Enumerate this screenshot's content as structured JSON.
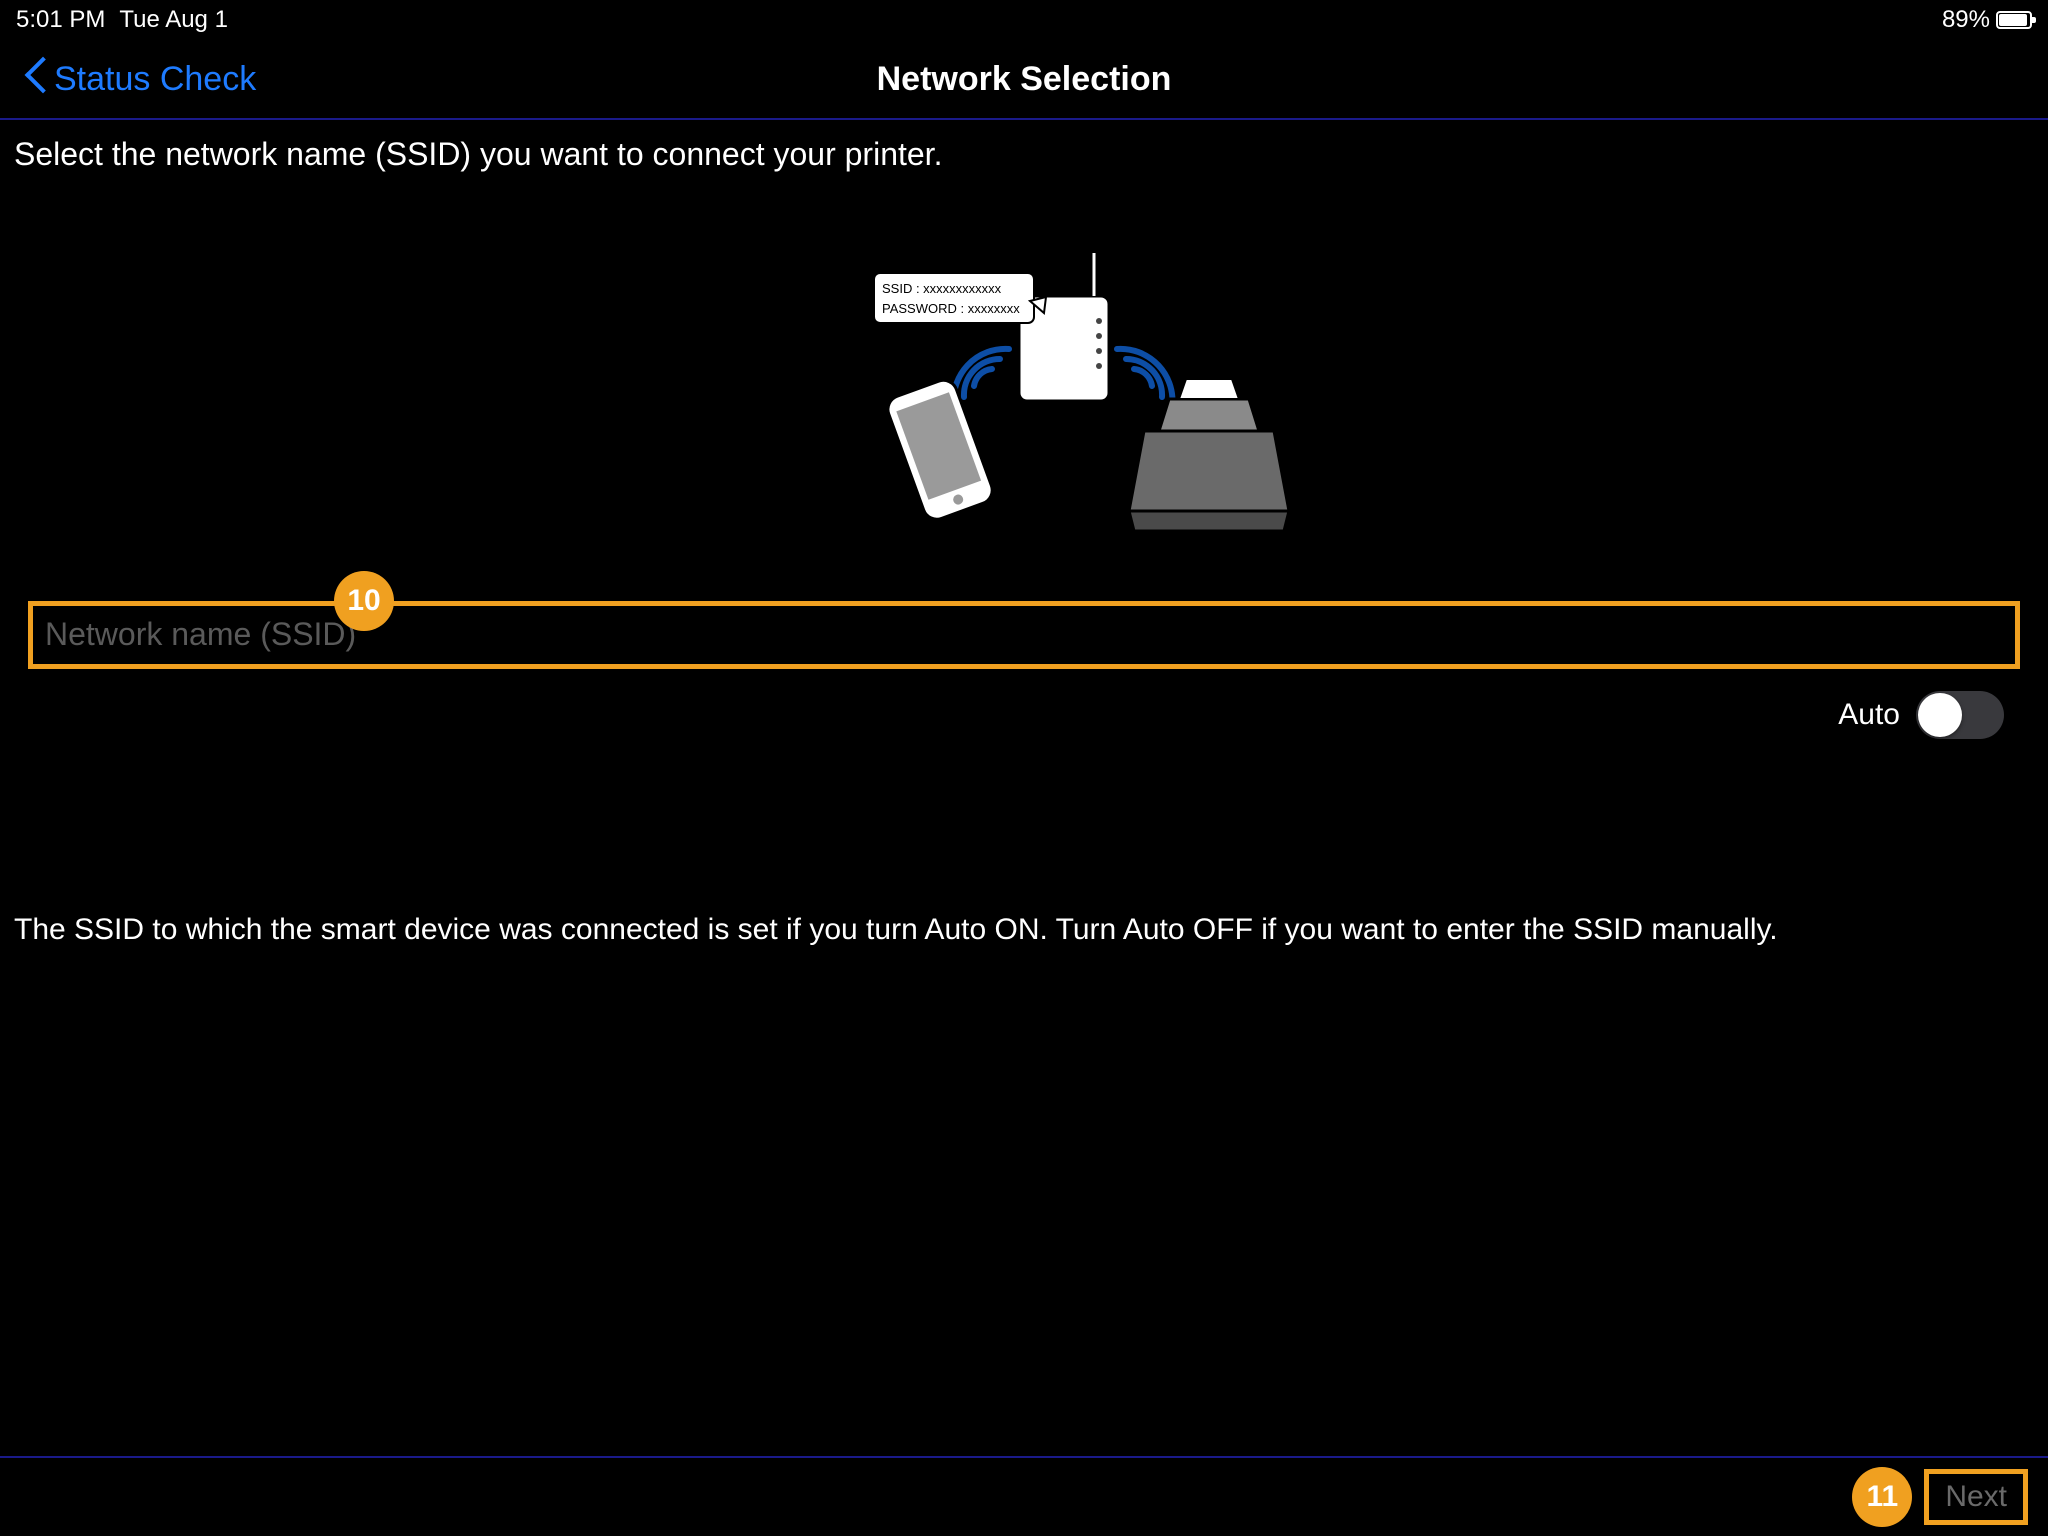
{
  "status": {
    "time": "5:01 PM",
    "date": "Tue Aug 1",
    "battery": "89%"
  },
  "nav": {
    "back": "Status Check",
    "title": "Network Selection"
  },
  "text": {
    "instruction1": "Select the network name (SSID) you want to connect your printer.",
    "instruction2": "The SSID to which the smart device was connected is set if you turn Auto ON. Turn Auto OFF if you want to enter the SSID manually."
  },
  "ssid": {
    "placeholder": "Network name (SSID)",
    "value": ""
  },
  "auto": {
    "label": "Auto",
    "on": false
  },
  "footer": {
    "next": "Next"
  },
  "badges": {
    "ssid": "10",
    "next": "11"
  },
  "illustration": {
    "bubble_line1": "SSID : xxxxxxxxxxxx",
    "bubble_line2": "PASSWORD : xxxxxxxx"
  },
  "colors": {
    "accent": "#f0a020",
    "link": "#1e7bff",
    "divider": "#1a1a8a"
  }
}
